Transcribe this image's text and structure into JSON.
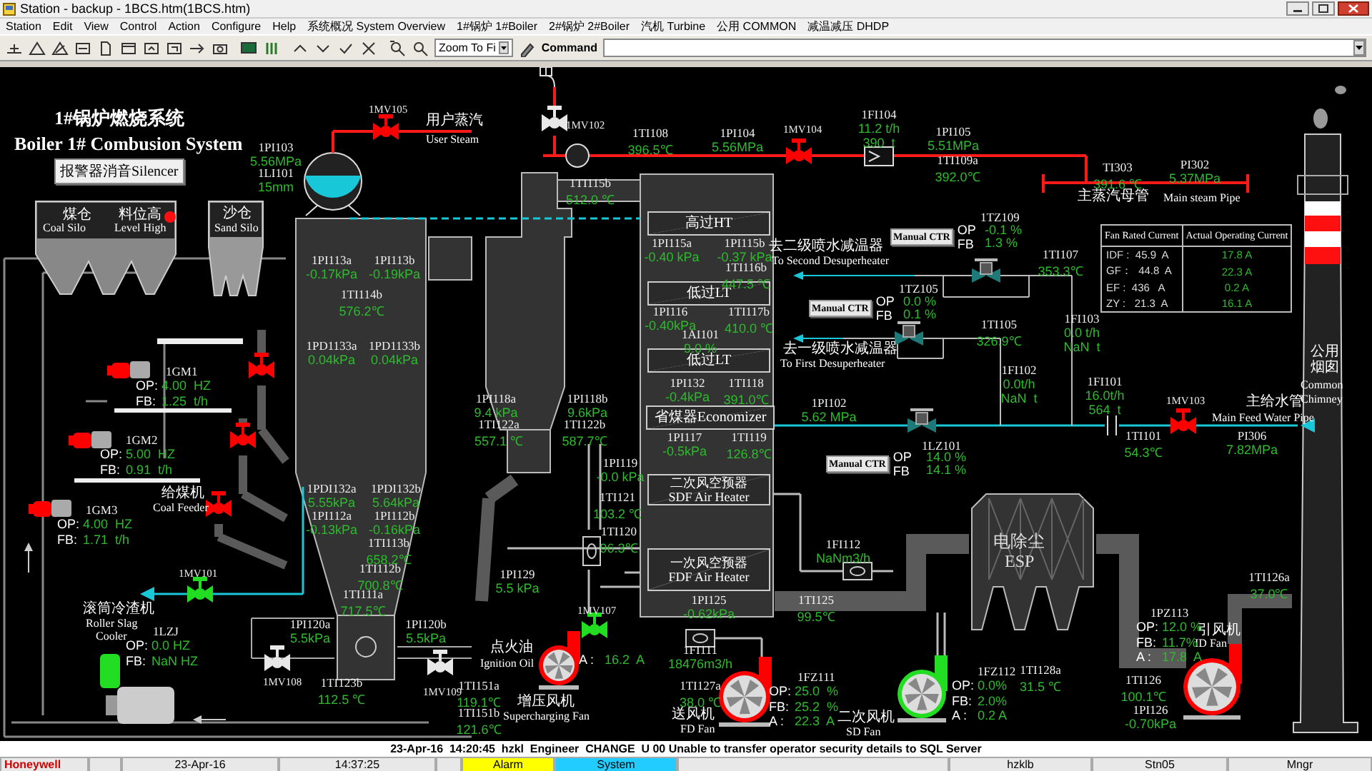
{
  "window": {
    "title": "Station - backup - 1BCS.htm(1BCS.htm)"
  },
  "menu": [
    "Station",
    "Edit",
    "View",
    "Control",
    "Action",
    "Configure",
    "Help",
    "系统概况 System Overview",
    "1#锅炉 1#Boiler",
    "2#锅炉 2#Boiler",
    "汽机 Turbine",
    "公用 COMMON",
    "减温减压 DHDP"
  ],
  "toolbar": {
    "zoom": "Zoom To Fi",
    "command_label": "Command"
  },
  "diagram": {
    "title_cn": "1#锅炉燃烧系统",
    "title_en": "Boiler 1# Combusion System",
    "silencer_button": "报警器消音Silencer",
    "level_high_alarm": true,
    "labels": [
      {
        "text": "煤仓"
      },
      {
        "text": "Coal Silo"
      },
      {
        "text": "料位高"
      },
      {
        "text": "Level High"
      },
      {
        "text": "沙仓"
      },
      {
        "text": "Sand Silo"
      },
      {
        "text": "用户蒸汽"
      },
      {
        "text": "User Steam"
      },
      {
        "text": "给煤机"
      },
      {
        "text": "Coal Feeder"
      },
      {
        "text": "滚筒冷渣机"
      },
      {
        "text": "Roller Slag"
      },
      {
        "text": "Cooler"
      },
      {
        "text": "点火油"
      },
      {
        "text": "Ignition Oil"
      },
      {
        "text": "增压风机"
      },
      {
        "text": "Supercharging Fan"
      },
      {
        "text": "送风机"
      },
      {
        "text": "FD Fan"
      },
      {
        "text": "二次风机"
      },
      {
        "text": "SD Fan"
      },
      {
        "text": "引风机"
      },
      {
        "text": "ID Fan"
      },
      {
        "text": "电除尘"
      },
      {
        "text": "ESP"
      },
      {
        "text": "去二级喷水减温器"
      },
      {
        "text": "To Second Desuperheater"
      },
      {
        "text": "去一级喷水减温器"
      },
      {
        "text": "To First Desuperheater"
      },
      {
        "text": "主蒸汽母管"
      },
      {
        "text": "Main steam Pipe"
      },
      {
        "text": "主给水管"
      },
      {
        "text": "Main Feed Water Pipe"
      },
      {
        "text": "公用"
      },
      {
        "text": "烟囱"
      },
      {
        "text": "Common"
      },
      {
        "text": "Chimney"
      }
    ],
    "exchangers": [
      {
        "lines": [
          "高过HT"
        ]
      },
      {
        "lines": [
          "低过LT"
        ]
      },
      {
        "lines": [
          "低过LT"
        ]
      },
      {
        "lines": [
          "省煤器Economizer"
        ]
      },
      {
        "lines": [
          "二次风空预器",
          "SDF Air Heater"
        ]
      },
      {
        "lines": [
          "一次风空预器",
          "FDF Air Heater"
        ]
      }
    ],
    "points": [
      {
        "tag": "1PI103",
        "values": [
          "5.56MPa"
        ]
      },
      {
        "tag": "1LI101",
        "values": [
          "15mm"
        ]
      },
      {
        "tag": "1PI113a",
        "values": [
          "-0.17kPa"
        ]
      },
      {
        "tag": "1PI113b",
        "values": [
          "-0.19kPa"
        ]
      },
      {
        "tag": "1TI114b",
        "values": [
          "576.2℃"
        ]
      },
      {
        "tag": "1PD1133a",
        "values": [
          "0.04kPa"
        ]
      },
      {
        "tag": "1PD1133b",
        "values": [
          "0.04kPa"
        ]
      },
      {
        "tag": "1PDI132a",
        "values": [
          "5.55kPa"
        ]
      },
      {
        "tag": "1PDI132b",
        "values": [
          "5.64kPa"
        ]
      },
      {
        "tag": "1PI112a",
        "values": [
          "-0.13kPa"
        ]
      },
      {
        "tag": "1PI112b",
        "values": [
          "-0.16kPa"
        ]
      },
      {
        "tag": "1TI113b",
        "values": [
          "658.2℃"
        ]
      },
      {
        "tag": "1TI112b",
        "values": [
          "700.8℃"
        ]
      },
      {
        "tag": "1TI111a",
        "values": [
          "717.5℃"
        ]
      },
      {
        "tag": "1PI120a",
        "values": [
          "5.5kPa"
        ]
      },
      {
        "tag": "1PI120b",
        "values": [
          "5.5kPa"
        ]
      },
      {
        "tag": "1TI123b",
        "values": [
          "112.5 ℃"
        ]
      },
      {
        "tag": "1TI151a",
        "values": [
          "119.1℃"
        ]
      },
      {
        "tag": "1TI151b",
        "values": [
          "121.6℃"
        ]
      },
      {
        "tag": "1TI108",
        "values": [
          "396.5℃"
        ]
      },
      {
        "tag": "1PI104",
        "values": [
          "5.56MPa"
        ]
      },
      {
        "tag": "1FI104",
        "values": [
          "11.2 t/h",
          "390  t"
        ]
      },
      {
        "tag": "1PI105",
        "values": [
          "5.51MPa"
        ]
      },
      {
        "tag": "1TI109a",
        "values": [
          "392.0℃"
        ]
      },
      {
        "tag": "TI303",
        "values": [
          "391.6 ℃"
        ]
      },
      {
        "tag": "PI302",
        "values": [
          "5.37MPa"
        ]
      },
      {
        "tag": "1TI115b",
        "values": [
          "512.0 ℃"
        ]
      },
      {
        "tag": "1PI115a",
        "values": [
          "-0.40 kPa"
        ]
      },
      {
        "tag": "1PI115b",
        "values": [
          "-0.37 kPa"
        ]
      },
      {
        "tag": "1TI116b",
        "values": [
          "447.5 ℃"
        ]
      },
      {
        "tag": "1PI116",
        "values": [
          "-0.40kPa"
        ]
      },
      {
        "tag": "1TI117b",
        "values": [
          "410.0 ℃"
        ]
      },
      {
        "tag": "1AI101",
        "values": [
          "9.0 %"
        ]
      },
      {
        "tag": "1PI132",
        "values": [
          "-0.4kPa"
        ]
      },
      {
        "tag": "1TI118",
        "values": [
          "391.0℃"
        ]
      },
      {
        "tag": "1PI117",
        "values": [
          "-0.5kPa"
        ]
      },
      {
        "tag": "1TI119",
        "values": [
          "126.8℃"
        ]
      },
      {
        "tag": "1PI118a",
        "values": [
          "9.4 kPa"
        ]
      },
      {
        "tag": "1PI118b",
        "values": [
          "9.6kPa"
        ]
      },
      {
        "tag": "1TI122a",
        "values": [
          "557.1 ℃"
        ]
      },
      {
        "tag": "1TI122b",
        "values": [
          "587.7℃"
        ]
      },
      {
        "tag": "1PI119",
        "values": [
          "-0.0 kPa"
        ]
      },
      {
        "tag": "1TI121",
        "values": [
          "103.2 ℃"
        ]
      },
      {
        "tag": "1TI120",
        "values": [
          "96.3℃"
        ]
      },
      {
        "tag": "1PI129",
        "values": [
          "5.5 kPa"
        ]
      },
      {
        "tag": "1PI125",
        "values": [
          "-0.62kPa"
        ]
      },
      {
        "tag": "1TI125",
        "values": [
          "99.5℃"
        ]
      },
      {
        "tag": "1FI111",
        "values": [
          "18476m3/h"
        ]
      },
      {
        "tag": "1TI127a",
        "values": [
          "38.0 ℃"
        ]
      },
      {
        "tag": "1FI112",
        "values": [
          "NaNm3/h"
        ]
      },
      {
        "tag": "1TI128a",
        "values": [
          "31.5 ℃"
        ]
      },
      {
        "tag": "1TI126a",
        "values": [
          "37.0℃"
        ]
      },
      {
        "tag": "1TI126",
        "values": [
          "100.1℃"
        ]
      },
      {
        "tag": "1PI126",
        "values": [
          "-0.70kPa"
        ]
      },
      {
        "tag": "1TI107",
        "values": [
          "353.3℃"
        ]
      },
      {
        "tag": "1TI105",
        "values": [
          "326.9℃"
        ]
      },
      {
        "tag": "1FI103",
        "values": [
          "0.0 t/h",
          "NaN  t"
        ]
      },
      {
        "tag": "1FI102",
        "values": [
          "0.0t/h",
          "NaN  t"
        ]
      },
      {
        "tag": "1PI102",
        "values": [
          "5.62 MPa"
        ]
      },
      {
        "tag": "1FI101",
        "values": [
          "16.0t/h",
          "564  t"
        ]
      },
      {
        "tag": "1TI101",
        "values": [
          "54.3℃"
        ]
      },
      {
        "tag": "PI306",
        "values": [
          "7.82MPa"
        ]
      }
    ],
    "readouts": [
      {
        "tag": "1GM1",
        "color": "#ff0000",
        "rows": [
          {
            "label": "OP:",
            "value": "4.00  HZ"
          },
          {
            "label": "FB:",
            "value": "1.25  t/h"
          }
        ]
      },
      {
        "tag": "1GM2",
        "color": "#ff0000",
        "rows": [
          {
            "label": "OP:",
            "value": "5.00  HZ"
          },
          {
            "label": "FB:",
            "value": "0.91  t/h"
          }
        ]
      },
      {
        "tag": "1GM3",
        "color": "#ff0000",
        "rows": [
          {
            "label": "OP:",
            "value": "4.00  HZ"
          },
          {
            "label": "FB:",
            "value": "1.71  t/h"
          }
        ]
      },
      {
        "tag": "1LZJ",
        "color": "#22dd22",
        "rows": [
          {
            "label": "OP:",
            "value": "0.0 HZ"
          },
          {
            "label": "FB:",
            "value": "NaN HZ"
          }
        ]
      },
      {
        "rows": [
          {
            "label": "A :",
            "value": "16.2  A"
          }
        ]
      },
      {
        "tag": "1FZ111",
        "rows": [
          {
            "label": "OP:",
            "value": "25.0  %"
          },
          {
            "label": "FB:",
            "value": "25.2  %"
          },
          {
            "label": "A :",
            "value": "22.3  A"
          }
        ]
      },
      {
        "tag": "1FZ112",
        "rows": [
          {
            "label": "OP:",
            "value": "0.0%"
          },
          {
            "label": "FB:",
            "value": "2.0%"
          },
          {
            "label": "A :",
            "value": "0.2 A"
          }
        ]
      },
      {
        "tag": "1PZ113",
        "rows": [
          {
            "label": "OP:",
            "value": "12.0 %"
          },
          {
            "label": "FB:",
            "value": "11.7%"
          },
          {
            "label": "A :",
            "value": "17.8  A"
          }
        ]
      }
    ],
    "controllers": [
      {
        "button": "Manual CTR",
        "op_label": "OP",
        "fb_label": "FB",
        "tag": "1TZ109",
        "op": "-0.1 %",
        "fb": "1.3 %"
      },
      {
        "button": "Manual CTR",
        "op_label": "OP",
        "fb_label": "FB",
        "tag": "1TZ105",
        "op": "0.0 %",
        "fb": "0.1 %"
      },
      {
        "button": "Manual CTR",
        "op_label": "OP",
        "fb_label": "FB",
        "tag": "1LZ101",
        "op": "14.0 %",
        "fb": "14.1 %"
      }
    ],
    "valves": [
      {
        "tag": "1MV105",
        "color": "#ff0000"
      },
      {
        "tag": "1MV102",
        "color": "#e8e8e8"
      },
      {
        "tag": "1MV104",
        "color": "#ff0000"
      },
      {
        "tag": "1MV101",
        "color": "#22dd22"
      },
      {
        "tag": "1MV107",
        "color": "#22dd22"
      },
      {
        "tag": "1MV108",
        "color": "#e8e8e8"
      },
      {
        "tag": "1MV109",
        "color": "#e8e8e8"
      },
      {
        "tag": "1MV103",
        "color": "#ff0000"
      },
      {
        "color": "#ff0000"
      },
      {
        "color": "#ff0000"
      },
      {
        "color": "#ff0000"
      }
    ],
    "fans": [
      {
        "color": "#ff0000"
      },
      {
        "color": "#ff0000"
      },
      {
        "color": "#22dd22"
      },
      {
        "color": "#ff0000"
      }
    ],
    "fan_table": {
      "headers": [
        "Fan Rated Current",
        "Actual Operating Current"
      ],
      "rows": [
        [
          "IDF :  45.9  A",
          "17.8 A"
        ],
        [
          "GF：  44.8  A",
          "22.3 A"
        ],
        [
          "EF :  436   A",
          "0.2 A"
        ],
        [
          "ZY :   21.3  A",
          "16.1 A"
        ]
      ]
    }
  },
  "status_message": "23-Apr-16  14:20:45  hzkl  Engineer  CHANGE  U 00 Unable to transfer operator security details to SQL Server",
  "status_bar": [
    {
      "text": "Honeywell",
      "kind": "brand"
    },
    {
      "text": "23-Apr-16",
      "kind": "plain"
    },
    {
      "text": "14:37:25",
      "kind": "plain"
    },
    {
      "text": "Alarm",
      "kind": "alarm"
    },
    {
      "text": "System",
      "kind": "system"
    },
    {
      "text": "hzklb",
      "kind": "plain"
    },
    {
      "text": "Stn05",
      "kind": "plain"
    },
    {
      "text": "Mngr",
      "kind": "plain"
    }
  ]
}
